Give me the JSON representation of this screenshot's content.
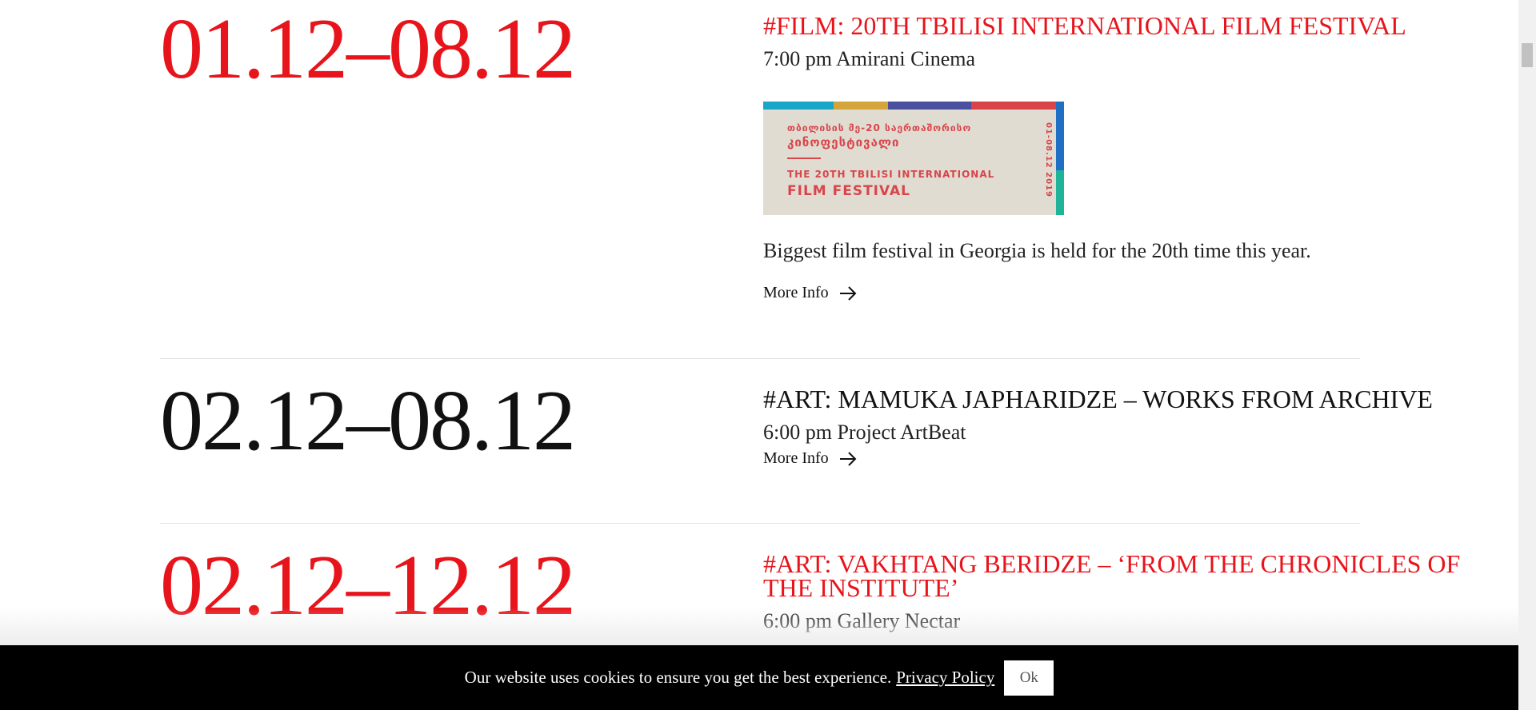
{
  "events": [
    {
      "date": "01.12–08.12",
      "title": "#FILM: 20TH TBILISI INTERNATIONAL FILM FESTIVAL",
      "meta": "7:00 pm Amirani Cinema",
      "description": "Biggest film festival in Georgia is held for the 20th time this year.",
      "more_label": "More Info",
      "accent": "#e8141b",
      "poster": {
        "line_ge_1": "თბილისის მე-20 საერთაშორისო",
        "line_ge_2": "კინოფესტივალი",
        "line_en_1": "THE 20TH TBILISI INTERNATIONAL",
        "line_en_2": "FILM FESTIVAL",
        "dates": "01-08.12 2019",
        "stripe_colors": [
          "#1aa6c8",
          "#d4a53a",
          "#4b4fa0",
          "#d9434a"
        ],
        "side_colors": [
          "#1f6fc4",
          "#1fb39a"
        ]
      }
    },
    {
      "date": "02.12–08.12",
      "title": "#ART: MAMUKA JAPHARIDZE – WORKS FROM ARCHIVE",
      "meta": "6:00 pm Project ArtBeat",
      "more_label": "More Info",
      "accent": "#111111"
    },
    {
      "date": "02.12–12.12",
      "title": "#ART: VAKHTANG BERIDZE – ‘FROM THE CHRONICLES OF THE INSTITUTE’",
      "meta": "6:00 pm Gallery Nectar",
      "accent": "#e8141b"
    }
  ],
  "cookie": {
    "text": "Our website uses cookies to ensure you get the best experience.",
    "link": "Privacy Policy",
    "button": "Ok"
  }
}
